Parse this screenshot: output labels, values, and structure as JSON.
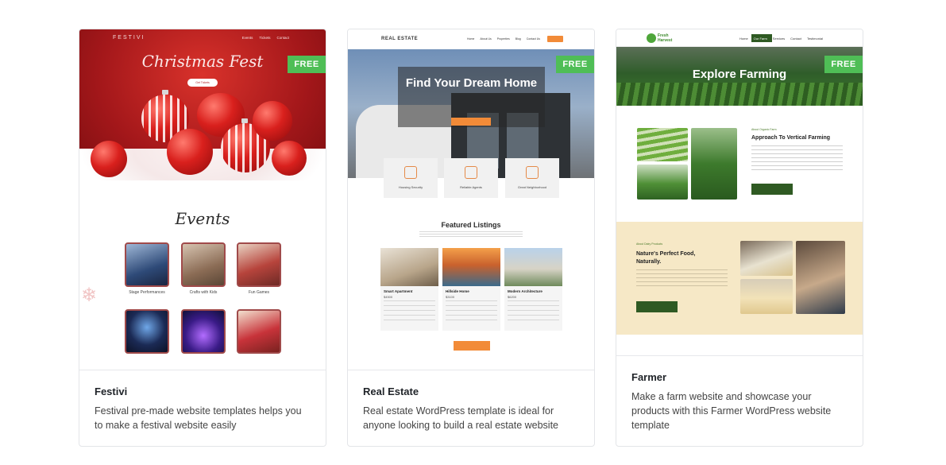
{
  "badge_label": "FREE",
  "cards": [
    {
      "title": "Festivi",
      "description": "Festival pre-made website templates helps you to make a festival website easily",
      "preview": {
        "brand": "FESTIVI",
        "nav": [
          "Events",
          "Tickets",
          "Contact"
        ],
        "hero_title": "Christmas Fest",
        "hero_button": "Get Tickets",
        "section_title": "Events",
        "events": [
          "Stage Performances",
          "Crafts with Kids",
          "Fun Games"
        ]
      }
    },
    {
      "title": "Real Estate",
      "description": "Real estate WordPress template is ideal for anyone looking to build a real estate website",
      "preview": {
        "logo": "REAL ESTATE",
        "nav": [
          "Home",
          "About Us",
          "Properties",
          "Blog",
          "Contact Us"
        ],
        "hero_title": "Find Your Dream Home",
        "features": [
          "Housing Security",
          "Reliable Agents",
          "Great Neighborhood"
        ],
        "section_title": "Featured Listings",
        "listings": [
          {
            "name": "Smart Apartment",
            "price": "$4500"
          },
          {
            "name": "Hillside Home",
            "price": "$3100"
          },
          {
            "name": "Modern Architecture",
            "price": "$6200"
          }
        ]
      }
    },
    {
      "title": "Farmer",
      "description": "Make a farm website and showcase your products with this Farmer WordPress website template",
      "preview": {
        "logo": "Fresh Harvest",
        "nav": [
          "Home",
          "Our Farm",
          "Services",
          "Contact",
          "Testimonial"
        ],
        "hero_title": "Explore Farming",
        "kicker": "About Organic Farm",
        "heading": "Approach To Vertical Farming",
        "button": "Discover More",
        "kicker2": "About Dairy Products",
        "heading2": "Nature's Perfect Food, Naturally.",
        "button2": "Discover More"
      }
    }
  ],
  "colors": {
    "badge": "#4fbe56",
    "festivi_red": "#c0201f",
    "realestate_orange": "#f28b38",
    "farmer_green": "#2f5a23",
    "farmer_cream": "#f6e8c6"
  }
}
